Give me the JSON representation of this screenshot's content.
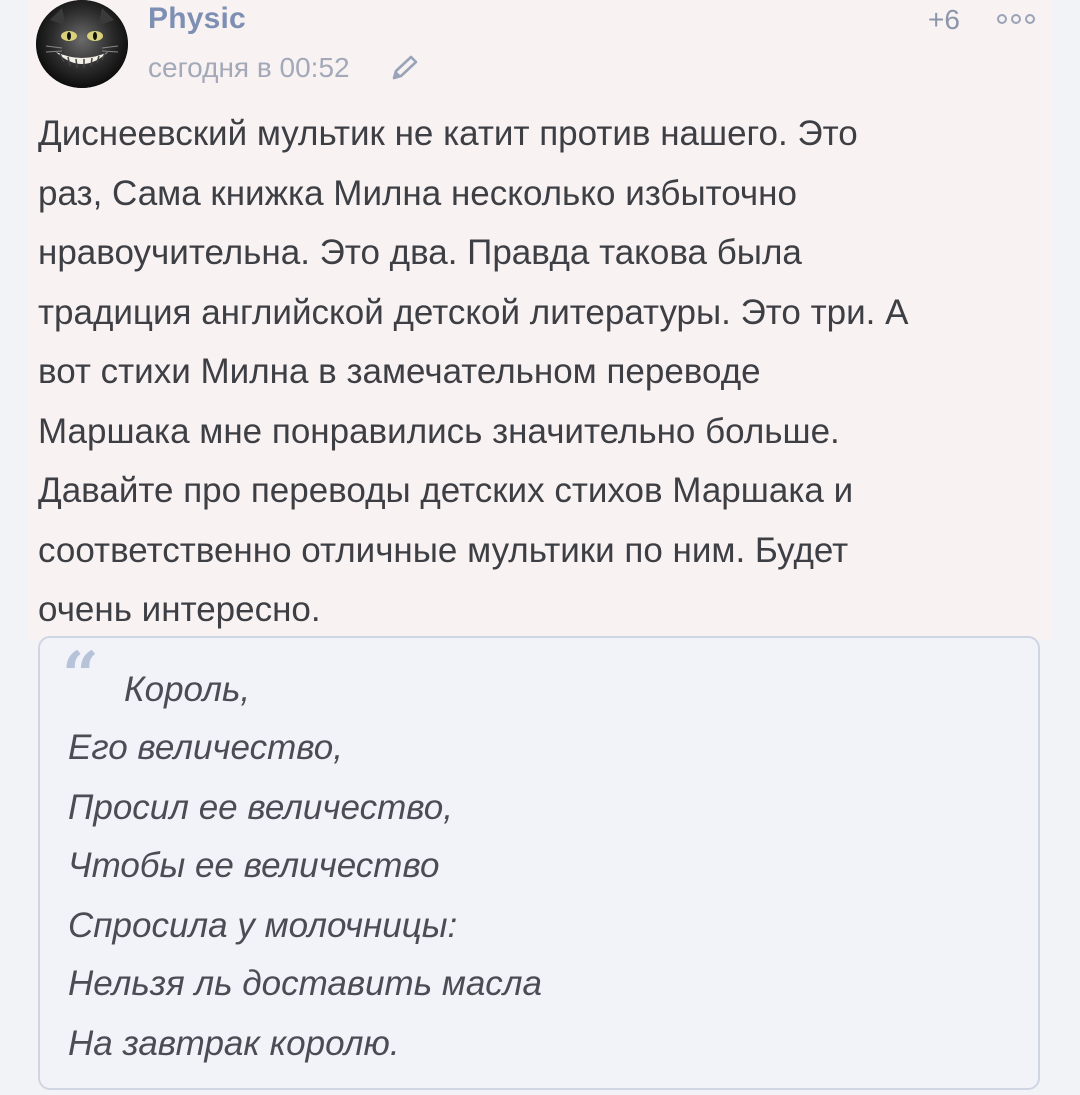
{
  "comment": {
    "author": "Physic",
    "timestamp": "сегодня в 00:52",
    "rating": "+6",
    "body": "Диснеевский мультик не катит против нашего. Это раз, Сама книжка Милна несколько избыточно нравоучительна. Это два. Правда такова была традиция английской детской литературы. Это три. А вот стихи Милна в замечательном переводе Маршака мне понравились значительно больше. Давайте про переводы детских стихов Маршака и соответственно отличные мультики по ним. Будет очень интересно.",
    "body_lines": [
      "Диснеевский мультик не катит против нашего. Это",
      "раз, Сама книжка Милна несколько избыточно",
      "нравоучительна. Это два. Правда такова была",
      "традиция английской детской литературы. Это три. А",
      "вот стихи Милна в замечательном переводе",
      "Маршака мне понравились значительно больше.",
      "Давайте про переводы детских стихов Маршака и",
      "соответственно отличные мультики по ним. Будет",
      "очень интересно."
    ],
    "quote_lines": [
      "Король,",
      "Его величество,",
      "Просил ее величество,",
      "Чтобы ее величество",
      "Спросила у молочницы:",
      "Нельзя ль доставить масла",
      "На завтрак королю."
    ]
  },
  "icons": {
    "avatar": "cheshire-cat-avatar",
    "edit": "pencil-icon",
    "more": "more-dots-icon",
    "quote": "quote-mark-icon"
  },
  "colors": {
    "author": "#7d8fb3",
    "meta": "#a3a9b8",
    "text": "#3d3f44",
    "quote_border": "#cfd5e2",
    "quote_bg": "#f1f3f9",
    "comment_bg": "#f8f2f2"
  }
}
